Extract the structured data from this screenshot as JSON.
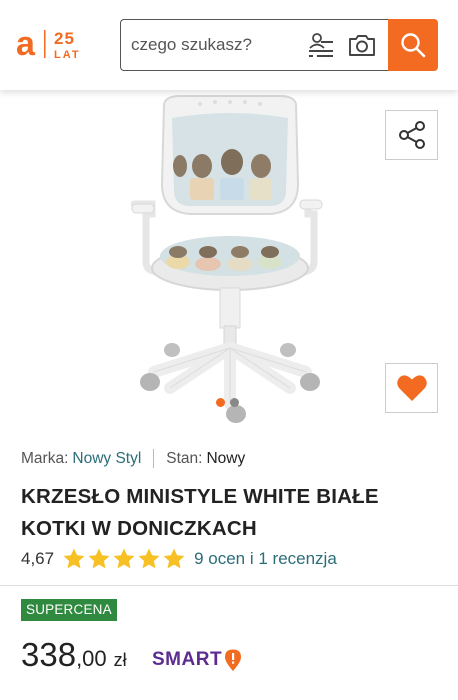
{
  "header": {
    "logo_letter": "a",
    "logo_number": "25",
    "logo_suffix": "LAT",
    "search_placeholder": "czego szukasz?",
    "accent_color": "#f36a21"
  },
  "gallery": {
    "image_count": 2,
    "active_image": 1,
    "share_icon": "share-icon",
    "favorite_icon": "heart-icon"
  },
  "product": {
    "brand_label": "Marka:",
    "brand_value": "Nowy Styl",
    "condition_label": "Stan:",
    "condition_value": "Nowy",
    "title": "KRZESŁO MINISTYLE WHITE BIAŁE KOTKI W DONICZKACH",
    "rating": "4,67",
    "stars_filled": 5,
    "reviews_text": "9 ocen i 1 recenzja",
    "badge": "SUPERCENA",
    "badge_color": "#2f8a3f",
    "price_int": "338",
    "price_frac": ",00",
    "currency": "zł",
    "smart_label": "SMART",
    "smart_color": "#5c2d91"
  }
}
